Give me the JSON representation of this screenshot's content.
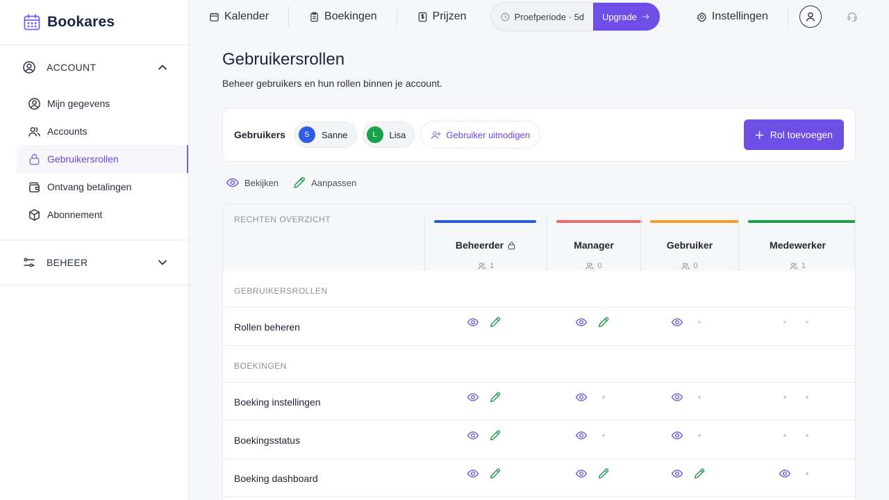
{
  "brand": {
    "name": "Bookares"
  },
  "sidebar": {
    "account_label": "ACCOUNT",
    "items": [
      {
        "label": "Mijn gegevens",
        "icon": "user-circle-icon"
      },
      {
        "label": "Accounts",
        "icon": "users-icon"
      },
      {
        "label": "Gebruikersrollen",
        "icon": "lock-icon",
        "active": true
      },
      {
        "label": "Ontvang betalingen",
        "icon": "wallet-icon"
      },
      {
        "label": "Abonnement",
        "icon": "box-icon"
      }
    ],
    "beheer_label": "BEHEER"
  },
  "topbar": {
    "tabs": [
      {
        "label": "Kalender",
        "icon": "calendar-icon"
      },
      {
        "label": "Boekingen",
        "icon": "clipboard-icon"
      },
      {
        "label": "Prijzen",
        "icon": "price-tag-icon"
      }
    ],
    "trial_label": "Proefperiode · 5d",
    "upgrade_label": "Upgrade",
    "settings_label": "Instellingen"
  },
  "page": {
    "title": "Gebruikersrollen",
    "subtitle": "Beheer gebruikers en hun rollen binnen je account."
  },
  "users": {
    "label": "Gebruikers",
    "list": [
      {
        "initial": "S",
        "name": "Sanne",
        "color": "#2f5ce5"
      },
      {
        "initial": "L",
        "name": "Lisa",
        "color": "#16a34a"
      }
    ],
    "invite_label": "Gebruiker uitnodigen",
    "add_role_label": "Rol toevoegen"
  },
  "legend": {
    "view_label": "Bekijken",
    "edit_label": "Aanpassen"
  },
  "matrix": {
    "header_label": "RECHTEN OVERZICHT",
    "roles": [
      {
        "name": "Beheerder",
        "count": "1",
        "color": "#2458e6",
        "locked": true
      },
      {
        "name": "Manager",
        "count": "0",
        "color": "#ef6b6b",
        "locked": false
      },
      {
        "name": "Gebruiker",
        "count": "0",
        "color": "#f59e2b",
        "locked": false
      },
      {
        "name": "Medewerker",
        "count": "1",
        "color": "#16a34a",
        "locked": false
      }
    ],
    "groups": [
      {
        "label": "GEBRUIKERSROLLEN",
        "rows": [
          {
            "label": "Rollen beheren",
            "perms": [
              [
                "v",
                "e"
              ],
              [
                "v",
                "e"
              ],
              [
                "v",
                "-"
              ],
              [
                "-",
                "-"
              ]
            ]
          }
        ]
      },
      {
        "label": "BOEKINGEN",
        "rows": [
          {
            "label": "Boeking instellingen",
            "perms": [
              [
                "v",
                "e"
              ],
              [
                "v",
                "-"
              ],
              [
                "v",
                "-"
              ],
              [
                "-",
                "-"
              ]
            ]
          },
          {
            "label": "Boekingsstatus",
            "perms": [
              [
                "v",
                "e"
              ],
              [
                "v",
                "-"
              ],
              [
                "v",
                "-"
              ],
              [
                "-",
                "-"
              ]
            ]
          },
          {
            "label": "Boeking dashboard",
            "perms": [
              [
                "v",
                "e"
              ],
              [
                "v",
                "e"
              ],
              [
                "v",
                "e"
              ],
              [
                "v",
                "-"
              ]
            ]
          }
        ]
      }
    ],
    "colors": {
      "view": "#6b5ce0",
      "edit": "#1f9d4f"
    }
  }
}
